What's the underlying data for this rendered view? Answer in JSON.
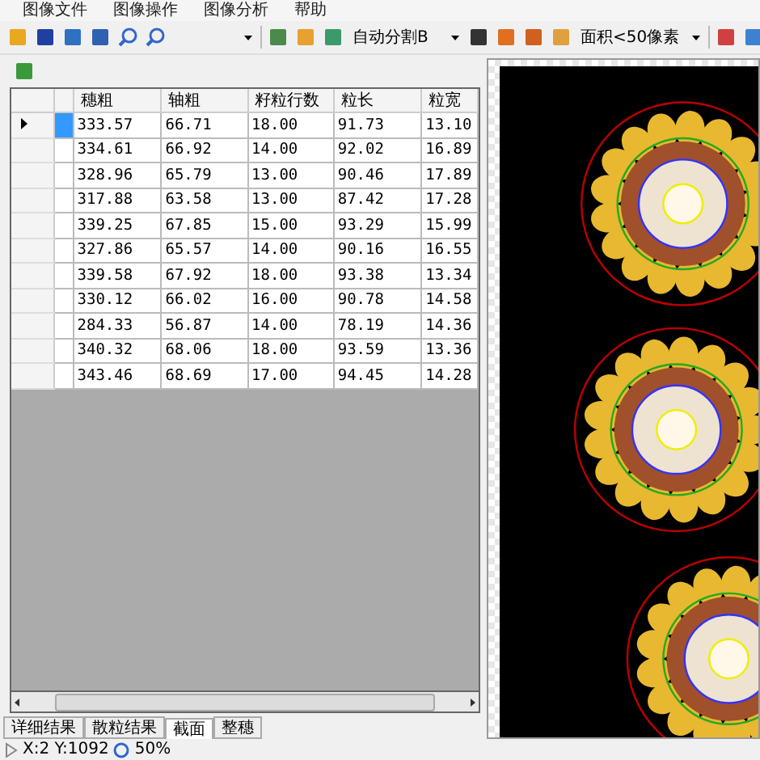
{
  "menu": [
    "图像文件",
    "图像操作",
    "图像分析",
    "帮助"
  ],
  "toolbar": {
    "dropdowns": [
      {
        "value": "自动分割B"
      },
      {
        "value": "面积<50像素"
      }
    ]
  },
  "table": {
    "columns": [
      "穗粗",
      "轴粗",
      "籽粒行数",
      "粒长",
      "粒宽"
    ],
    "rows": [
      {
        "selected": true,
        "cells": [
          "333.57",
          "66.71",
          "18.00",
          "91.73",
          "13.10"
        ]
      },
      {
        "selected": false,
        "cells": [
          "334.61",
          "66.92",
          "14.00",
          "92.02",
          "16.89"
        ]
      },
      {
        "selected": false,
        "cells": [
          "328.96",
          "65.79",
          "13.00",
          "90.46",
          "17.89"
        ]
      },
      {
        "selected": false,
        "cells": [
          "317.88",
          "63.58",
          "13.00",
          "87.42",
          "17.28"
        ]
      },
      {
        "selected": false,
        "cells": [
          "339.25",
          "67.85",
          "15.00",
          "93.29",
          "15.99"
        ]
      },
      {
        "selected": false,
        "cells": [
          "327.86",
          "65.57",
          "14.00",
          "90.16",
          "16.55"
        ]
      },
      {
        "selected": false,
        "cells": [
          "339.58",
          "67.92",
          "18.00",
          "93.38",
          "13.34"
        ]
      },
      {
        "selected": false,
        "cells": [
          "330.12",
          "66.02",
          "16.00",
          "90.78",
          "14.58"
        ]
      },
      {
        "selected": false,
        "cells": [
          "284.33",
          "56.87",
          "14.00",
          "78.19",
          "14.36"
        ]
      },
      {
        "selected": false,
        "cells": [
          "340.32",
          "68.06",
          "18.00",
          "93.59",
          "13.36"
        ]
      },
      {
        "selected": false,
        "cells": [
          "343.46",
          "68.69",
          "17.00",
          "94.45",
          "14.28"
        ]
      }
    ]
  },
  "tabs": [
    {
      "label": "详细结果",
      "selected": false
    },
    {
      "label": "散粒结果",
      "selected": false
    },
    {
      "label": "截面",
      "selected": true
    },
    {
      "label": "整穗",
      "selected": false
    }
  ],
  "status_bar": {
    "coords": "X:2  Y:1092",
    "zoom": "50%"
  }
}
